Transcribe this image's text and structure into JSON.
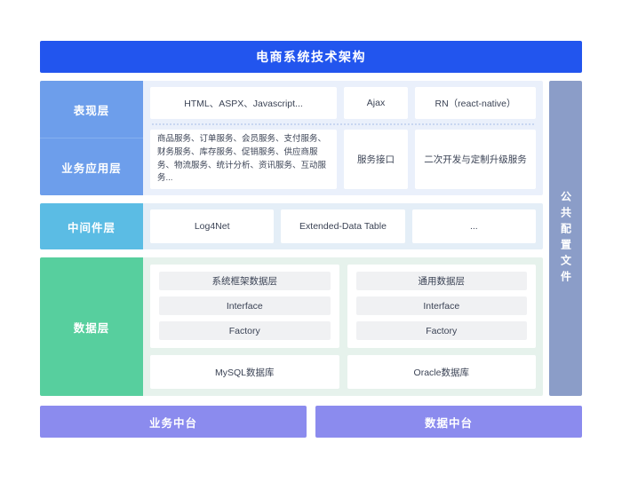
{
  "title": "电商系统技术架构",
  "layers": {
    "presentation": {
      "label": "表现层",
      "items": [
        "HTML、ASPX、Javascript...",
        "Ajax",
        "RN（react-native）"
      ]
    },
    "business": {
      "label": "业务应用层",
      "items": [
        "商品服务、订单服务、会员服务、支付服务、财务服务、库存服务、促销服务、供应商服务、物流服务、统计分析、资讯服务、互动服务...",
        "服务接口",
        "二次开发与定制升级服务"
      ]
    },
    "middleware": {
      "label": "中间件层",
      "items": [
        "Log4Net",
        "Extended-Data Table",
        "..."
      ]
    },
    "data": {
      "label": "数据层",
      "columns": [
        {
          "chips": [
            "系统框架数据层",
            "Interface",
            "Factory"
          ]
        },
        {
          "chips": [
            "通用数据层",
            "Interface",
            "Factory"
          ]
        }
      ],
      "databases": [
        "MySQL数据库",
        "Oracle数据库"
      ]
    }
  },
  "rail": {
    "label": "公共配置文件"
  },
  "bottom": {
    "bars": [
      "业务中台",
      "数据中台"
    ]
  },
  "colors": {
    "title_bar": "#2255ee",
    "presentation_label": "#6d9eeb",
    "middleware_label": "#5bbce4",
    "data_label": "#57cf9e",
    "rail": "#8b9dc8",
    "bottom_bar": "#8b8bee"
  }
}
